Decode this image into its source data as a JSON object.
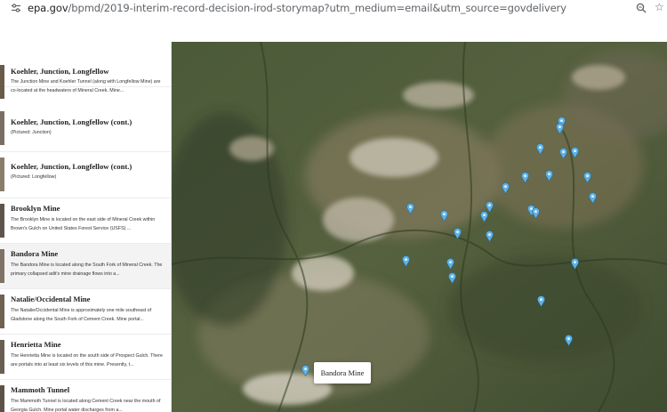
{
  "browser": {
    "url_host": "epa.gov",
    "url_path": "/bpmd/2019-interim-record-decision-irod-storymap?utm_medium=email&utm_source=govdelivery"
  },
  "sidebar": {
    "items": [
      {
        "title": "Koehler, Junction, Longfellow",
        "desc": "The Junction Mine and Koehler Tunnel (along with Longfellow Mine) are co-located at the headwaters of Mineral Creek. Mine..."
      },
      {
        "title": "Koehler, Junction, Longfellow (cont.)",
        "desc": "(Pictured: Junction)"
      },
      {
        "title": "Koehler, Junction, Longfellow (cont.)",
        "desc": "(Pictured: Longfellow)"
      },
      {
        "title": "Brooklyn Mine",
        "desc": "The Brooklyn Mine is located on the east side of Mineral Creek within Brown's Gulch on United States Forest Service (USFS) ..."
      },
      {
        "title": "Bandora Mine",
        "desc": "The Bandora Mine is located along the South Fork of Mineral Creek. The primary collapsed adit's mine drainage flows into a..."
      },
      {
        "title": "Natalie/Occidental Mine",
        "desc": "The Natalie/Occidental Mine is approximately one mile southeast of Gladstone along the South Fork of Cement Creek. Mine portal..."
      },
      {
        "title": "Henrietta Mine",
        "desc": "The Henrietta Mine is located on the south side of Prospect Gulch. There are portals into at least six levels of this mine. Presently, t..."
      },
      {
        "title": "Mammoth Tunnel",
        "desc": "The Mammoth Tunnel is located along Cement Creek near the mouth of Georgia Gulch. Mine portal water discharges from a..."
      }
    ]
  },
  "map": {
    "tooltip": "Bandora Mine",
    "pin_color": "#5fb3e6",
    "pin_count": 28
  }
}
